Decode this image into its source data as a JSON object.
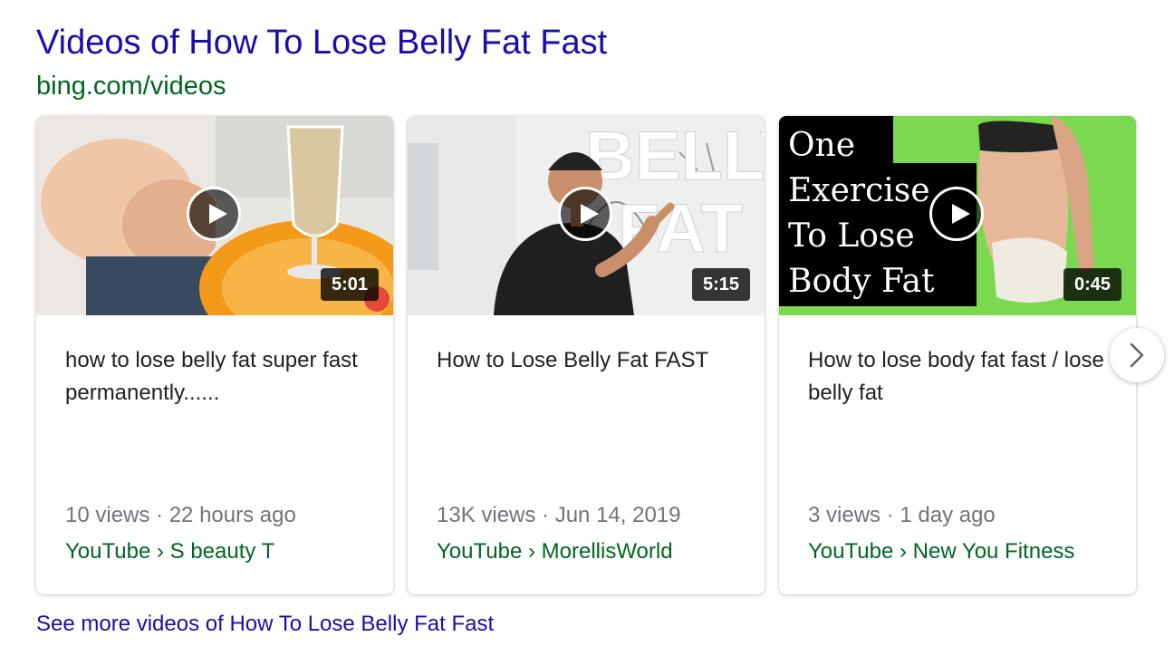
{
  "header": {
    "title": "Videos of How To Lose Belly Fat Fast",
    "source_url": "bing.com/videos"
  },
  "videos": [
    {
      "title": "how to lose belly fat super fast permanently......",
      "duration": "5:01",
      "meta": "10 views · 22 hours ago",
      "source": "YouTube › S beauty T"
    },
    {
      "title": "How to Lose Belly Fat FAST",
      "duration": "5:15",
      "meta": "13K views · Jun 14, 2019",
      "source": "YouTube › MorellisWorld",
      "thumb_text": [
        "BELLY",
        "FAT"
      ]
    },
    {
      "title": "How to lose body fat fast / lose belly fat",
      "duration": "0:45",
      "meta": "3 views · 1 day ago",
      "source": "YouTube › New You Fitness",
      "thumb_text": [
        "One",
        "Exercise",
        "To Lose",
        "Body Fat"
      ]
    }
  ],
  "footer": {
    "more_link": "See more videos of How To Lose Belly Fat Fast"
  },
  "colors": {
    "title_link": "#1a0dab",
    "url_green": "#006621",
    "meta_gray": "#70757a",
    "thumb3_green": "#7ad94f"
  },
  "icons": {
    "play": "play-icon",
    "next": "chevron-right-icon"
  }
}
